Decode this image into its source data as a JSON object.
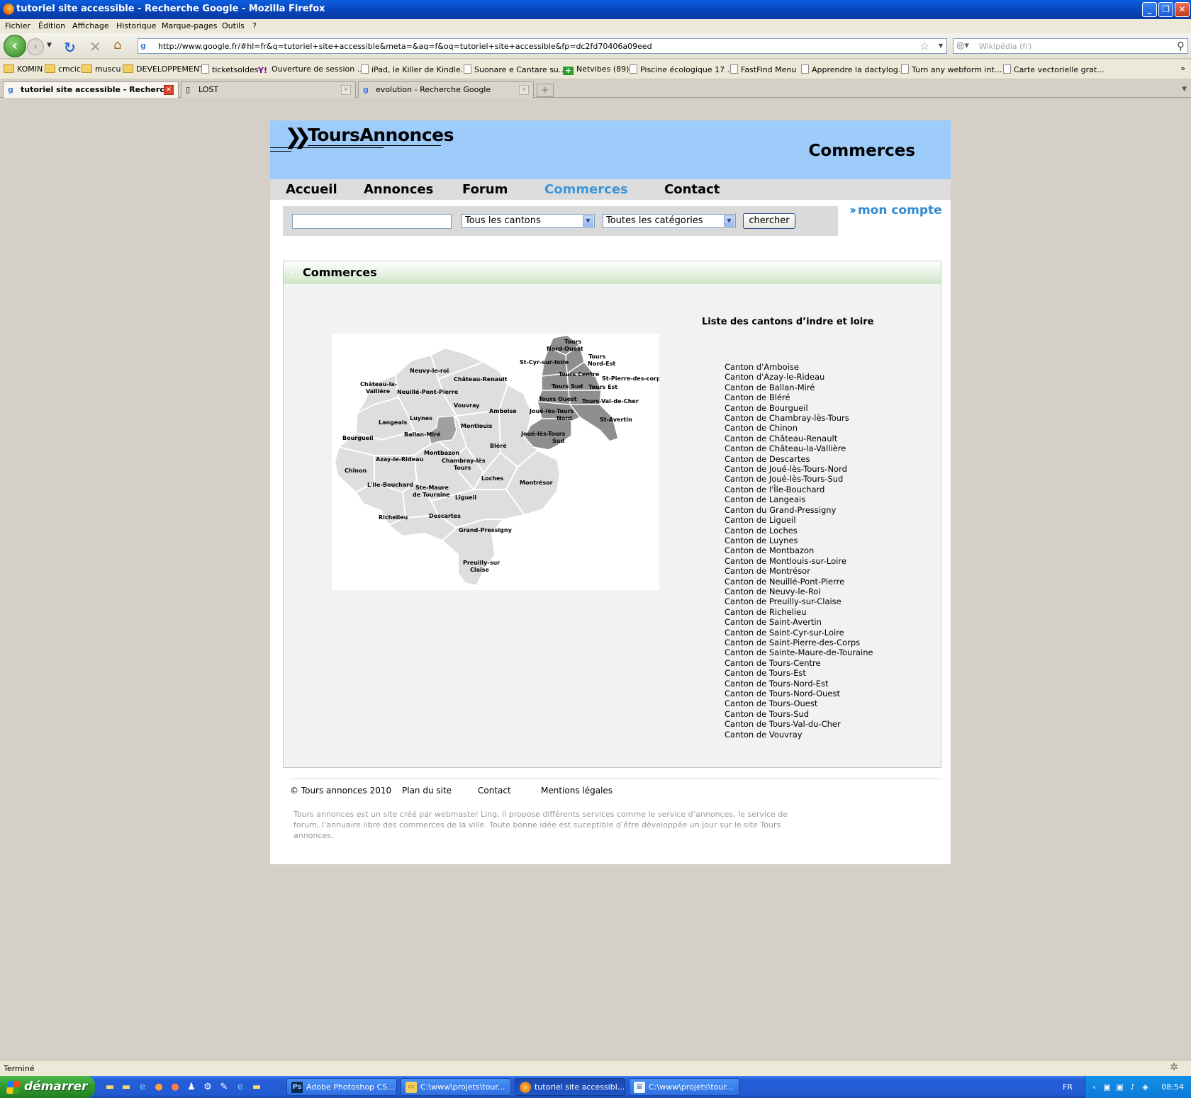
{
  "window": {
    "title": "tutoriel site accessible - Recherche Google - Mozilla Firefox",
    "controls": {
      "minimize": "_",
      "maximize": "❐",
      "close": "✕"
    }
  },
  "menu": [
    "Fichier",
    "Édition",
    "Affichage",
    "Historique",
    "Marque-pages",
    "Outils",
    "?"
  ],
  "navbar": {
    "url": "http://www.google.fr/#hl=fr&q=tutoriel+site+accessible&meta=&aq=f&oq=tutoriel+site+accessible&fp=dc2fd70406a09eed",
    "search_placeholder": "Wikipédia (fr)"
  },
  "bookmarks": [
    {
      "label": "KOMIN",
      "icon": "folder-icon"
    },
    {
      "label": "cmcic",
      "icon": "folder-icon"
    },
    {
      "label": "muscu",
      "icon": "folder-icon"
    },
    {
      "label": "DEVELOPPEMENT",
      "icon": "folder-icon"
    },
    {
      "label": "ticketsoldes",
      "icon": "page-icon"
    },
    {
      "label": "Ouverture de session ...",
      "icon": "yahoo-icon"
    },
    {
      "label": "iPad, le Killer de Kindle...",
      "icon": "page-icon"
    },
    {
      "label": "Suonare e Cantare su...",
      "icon": "page-icon"
    },
    {
      "label": "Netvibes (89)",
      "icon": "netvibes-icon"
    },
    {
      "label": "Piscine écologique 17 ...",
      "icon": "page-icon"
    },
    {
      "label": "FastFind Menu",
      "icon": "page-icon"
    },
    {
      "label": "Apprendre la dactylog...",
      "icon": "page-icon"
    },
    {
      "label": "Turn any webform int...",
      "icon": "page-icon"
    },
    {
      "label": "Carte vectorielle grat...",
      "icon": "page-icon"
    }
  ],
  "bookmarks_more": "»",
  "tabs": [
    {
      "label": "tutoriel site accessible - Recherc...",
      "active": true
    },
    {
      "label": "LOST",
      "active": false
    },
    {
      "label": "evolution - Recherche Google",
      "active": false
    }
  ],
  "site": {
    "logo": "ToursAnnonces",
    "header_title": "Commerces",
    "nav": [
      "Accueil",
      "Annonces",
      "Forum",
      "Commerces",
      "Contact"
    ],
    "nav_current": "Commerces",
    "search": {
      "input_value": "",
      "canton_select": "Tous les cantons",
      "category_select": "Toutes les catégories",
      "button": "chercher"
    },
    "account_link": "mon compte",
    "section_title": "Commerces",
    "list_title": "Liste des cantons d’indre et loire",
    "cantons": [
      "Canton d'Amboise",
      "Canton d'Azay-le-Rideau",
      "Canton de Ballan-Miré",
      "Canton de Bléré",
      "Canton de Bourgueil",
      "Canton de Chambray-lès-Tours",
      "Canton de Chinon",
      "Canton de Château-Renault",
      "Canton de Château-la-Vallière",
      "Canton de Descartes",
      "Canton de Joué-lès-Tours-Nord",
      "Canton de Joué-lès-Tours-Sud",
      "Canton de l'Île-Bouchard",
      "Canton de Langeais",
      "Canton du Grand-Pressigny",
      "Canton de Ligueil",
      "Canton de Loches",
      "Canton de Luynes",
      "Canton de Montbazon",
      "Canton de Montlouis-sur-Loire",
      "Canton de Montrésor",
      "Canton de Neuillé-Pont-Pierre",
      "Canton de Neuvy-le-Roi",
      "Canton de Preuilly-sur-Claise",
      "Canton de Richelieu",
      "Canton de Saint-Avertin",
      "Canton de Saint-Cyr-sur-Loire",
      "Canton de Saint-Pierre-des-Corps",
      "Canton de Sainte-Maure-de-Touraine",
      "Canton de Tours-Centre",
      "Canton de Tours-Est",
      "Canton de Tours-Nord-Est",
      "Canton de Tours-Nord-Ouest",
      "Canton de Tours-Ouest",
      "Canton de Tours-Sud",
      "Canton de Tours-Val-du-Cher",
      "Canton de Vouvray"
    ],
    "map_labels": {
      "neuvy": "Neuvy-le-roi",
      "chateau_renault": "Château-Renault",
      "chateau_la": "Château-la-",
      "valliere": "Vallière",
      "neuille": "Neuillé-Pont-Pierre",
      "vouvray": "Vouvray",
      "amboise": "Amboise",
      "luynes": "Luynes",
      "langeais": "Langeais",
      "ballan": "Ballan-Miré",
      "montlouis": "Montlouis",
      "bourgueil": "Bourgueil",
      "blere": "Bléré",
      "montbazon": "Montbazon",
      "azay": "Azay-le-Rideau",
      "chambray": "Chambray-lès",
      "chambray2": "Tours",
      "chinon": "Chinon",
      "loches": "Loches",
      "montresor": "Montrésor",
      "ile_bouchard": "L'Ile-Bouchard",
      "ste_maure": "Ste-Maure",
      "ste_maure2": "de Touraine",
      "ligueil": "Ligueil",
      "richelieu": "Richelieu",
      "descartes": "Descartes",
      "grand_pressigny": "Grand-Pressigny",
      "preuilly": "Preuilly-sur",
      "preuilly2": "Claise",
      "tours_no1": "Tours",
      "tours_no2": "Nord-Ouest",
      "st_cyr": "St-Cyr-sur-loire",
      "tours_ne1": "Tours",
      "tours_ne2": "Nord-Est",
      "tours_centre": "Tours Centre",
      "st_pierre": "St-Pierre-des-corps",
      "tours_sud": "Tours Sud",
      "tours_est": "Tours Est",
      "tours_ouest": "Tours Ouest",
      "tours_val": "Tours-Val-de-Cher",
      "joue_nord1": "Joué-lès-Tours",
      "joue_nord2": "Nord",
      "st_avertin": "St-Avertin",
      "joue_sud1": "Joué-lès-Tours",
      "joue_sud2": "Sud"
    },
    "footer": {
      "copyright": "© Tours annonces 2010",
      "links": [
        "Plan du site",
        "Contact",
        "Mentions légales"
      ],
      "text": "Tours annonces est un site créé par webmaster Ling, il propose différents services comme le service d’annonces, le service de forum, l’annuaire libre des commerces de la ville. Toute bonne idée est suceptible d’être développée un jour sur le site Tours annonces."
    }
  },
  "statusbar": {
    "text": "Terminé"
  },
  "taskbar": {
    "start": "démarrer",
    "tasks": [
      {
        "label": "Adobe Photoshop CS...",
        "icon": "photoshop-icon",
        "active": false
      },
      {
        "label": "C:\\www\\projets\\tour...",
        "icon": "folder-icon",
        "active": false
      },
      {
        "label": "tutoriel site accessibl...",
        "icon": "firefox-icon",
        "active": true
      },
      {
        "label": "C:\\www\\projets\\tour...",
        "icon": "notepad-icon",
        "active": false
      }
    ],
    "language": "FR",
    "clock": "08:54"
  }
}
